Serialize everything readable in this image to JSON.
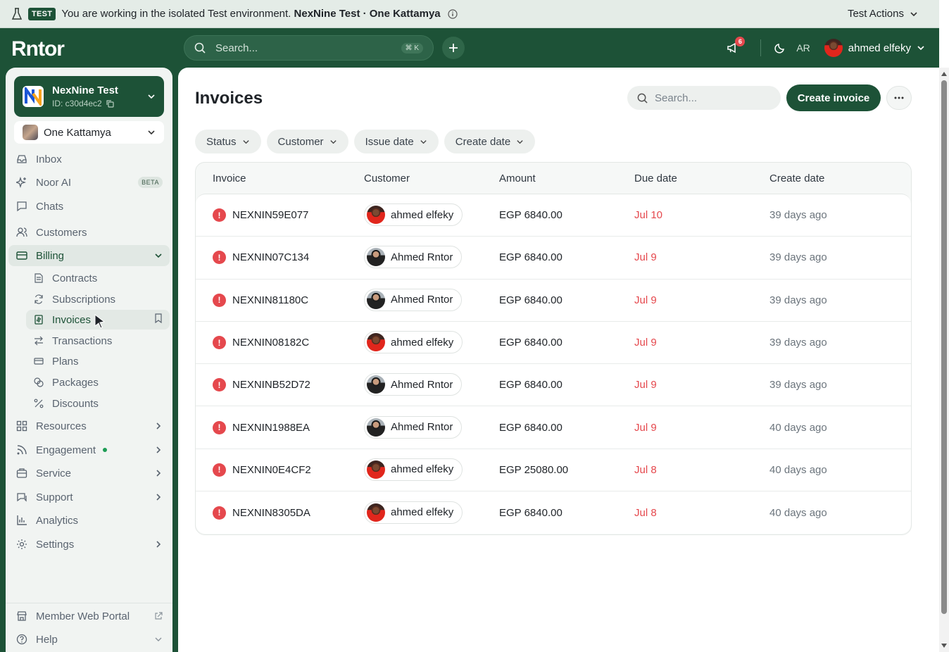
{
  "banner": {
    "tag": "TEST",
    "message": "You are working in the isolated Test environment.",
    "env_name": "NexNine Test · One Kattamya",
    "actions_label": "Test Actions"
  },
  "topbar": {
    "logo": "Rntor",
    "search_placeholder": "Search...",
    "search_shortcut": "⌘ K",
    "notification_count": "6",
    "lang": "AR",
    "user_name": "ahmed elfeky"
  },
  "org": {
    "name": "NexNine Test",
    "id": "ID: c30d4ec2",
    "location": "One Kattamya"
  },
  "nav": {
    "inbox": "Inbox",
    "noor_ai": "Noor AI",
    "beta": "BETA",
    "chats": "Chats",
    "customers": "Customers",
    "billing": "Billing",
    "contracts": "Contracts",
    "subscriptions": "Subscriptions",
    "invoices": "Invoices",
    "transactions": "Transactions",
    "plans": "Plans",
    "packages": "Packages",
    "discounts": "Discounts",
    "resources": "Resources",
    "engagement": "Engagement",
    "service": "Service",
    "support": "Support",
    "analytics": "Analytics",
    "settings": "Settings",
    "member_portal": "Member Web Portal",
    "help": "Help"
  },
  "main": {
    "title": "Invoices",
    "search_placeholder": "Search...",
    "create_label": "Create invoice",
    "filters": [
      "Status",
      "Customer",
      "Issue date",
      "Create date"
    ],
    "columns": [
      "Invoice",
      "Customer",
      "Amount",
      "Due date",
      "Create date"
    ],
    "rows": [
      {
        "invoice": "NEXNIN59E077",
        "customer": "ahmed elfeky",
        "avatar": "red",
        "amount": "EGP 6840.00",
        "due": "Jul 10",
        "created": "39 days ago"
      },
      {
        "invoice": "NEXNIN07C134",
        "customer": "Ahmed Rntor",
        "avatar": "dark",
        "amount": "EGP 6840.00",
        "due": "Jul 9",
        "created": "39 days ago"
      },
      {
        "invoice": "NEXNIN81180C",
        "customer": "Ahmed Rntor",
        "avatar": "dark",
        "amount": "EGP 6840.00",
        "due": "Jul 9",
        "created": "39 days ago"
      },
      {
        "invoice": "NEXNIN08182C",
        "customer": "ahmed elfeky",
        "avatar": "red",
        "amount": "EGP 6840.00",
        "due": "Jul 9",
        "created": "39 days ago"
      },
      {
        "invoice": "NEXNINB52D72",
        "customer": "Ahmed Rntor",
        "avatar": "dark",
        "amount": "EGP 6840.00",
        "due": "Jul 9",
        "created": "39 days ago"
      },
      {
        "invoice": "NEXNIN1988EA",
        "customer": "Ahmed Rntor",
        "avatar": "dark",
        "amount": "EGP 6840.00",
        "due": "Jul 9",
        "created": "40 days ago"
      },
      {
        "invoice": "NEXNIN0E4CF2",
        "customer": "ahmed elfeky",
        "avatar": "red",
        "amount": "EGP 25080.00",
        "due": "Jul 8",
        "created": "40 days ago"
      },
      {
        "invoice": "NEXNIN8305DA",
        "customer": "ahmed elfeky",
        "avatar": "red",
        "amount": "EGP 6840.00",
        "due": "Jul 8",
        "created": "40 days ago"
      }
    ]
  },
  "colors": {
    "brand": "#1d5237",
    "danger": "#e5484d"
  }
}
